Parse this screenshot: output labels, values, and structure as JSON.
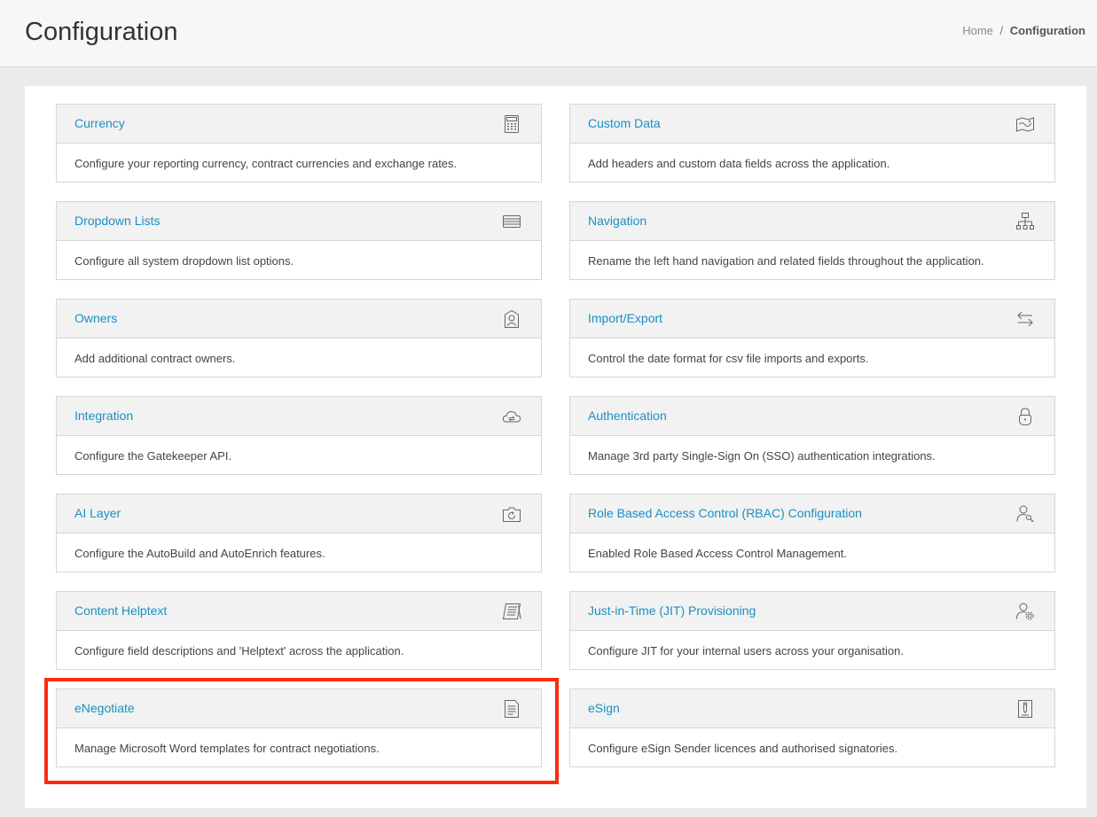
{
  "header": {
    "title": "Configuration",
    "breadcrumb": {
      "home": "Home",
      "separator": "/",
      "current": "Configuration"
    }
  },
  "cards": [
    {
      "title": "Currency",
      "description": "Configure your reporting currency, contract currencies and exchange rates.",
      "icon": "calculator-icon"
    },
    {
      "title": "Custom Data",
      "description": "Add headers and custom data fields across the application.",
      "icon": "map-icon"
    },
    {
      "title": "Dropdown Lists",
      "description": "Configure all system dropdown list options.",
      "icon": "list-icon"
    },
    {
      "title": "Navigation",
      "description": "Rename the left hand navigation and related fields throughout the application.",
      "icon": "sitemap-icon"
    },
    {
      "title": "Owners",
      "description": "Add additional contract owners.",
      "icon": "user-badge-icon"
    },
    {
      "title": "Import/Export",
      "description": "Control the date format for csv file imports and exports.",
      "icon": "swap-arrows-icon"
    },
    {
      "title": "Integration",
      "description": "Configure the Gatekeeper API.",
      "icon": "cloud-sync-icon"
    },
    {
      "title": "Authentication",
      "description": "Manage 3rd party Single-Sign On (SSO) authentication integrations.",
      "icon": "lock-icon"
    },
    {
      "title": "AI Layer",
      "description": "Configure the AutoBuild and AutoEnrich features.",
      "icon": "refresh-box-icon"
    },
    {
      "title": "Role Based Access Control (RBAC) Configuration",
      "description": "Enabled Role Based Access Control Management.",
      "icon": "user-key-icon"
    },
    {
      "title": "Content Helptext",
      "description": "Configure field descriptions and 'Helptext' across the application.",
      "icon": "book-icon"
    },
    {
      "title": "Just-in-Time (JIT) Provisioning",
      "description": "Configure JIT for your internal users across your organisation.",
      "icon": "user-settings-icon"
    },
    {
      "title": "eNegotiate",
      "description": "Manage Microsoft Word templates for contract negotiations.",
      "icon": "document-icon"
    },
    {
      "title": "eSign",
      "description": "Configure eSign Sender licences and authorised signatories.",
      "icon": "pen-document-icon"
    }
  ],
  "highlight_color": "#ff2a10",
  "link_color": "#1a8fc4"
}
